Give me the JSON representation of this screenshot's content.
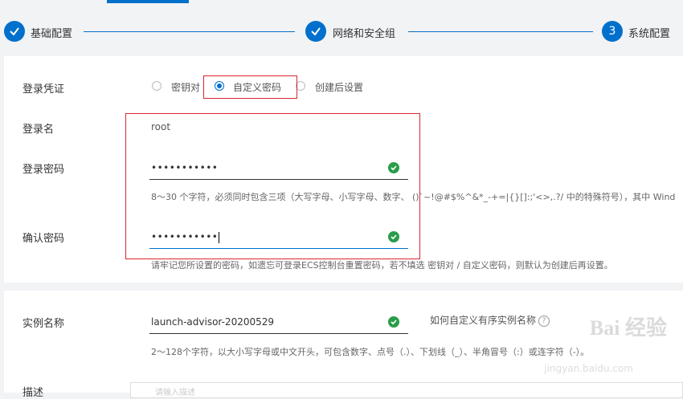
{
  "steps": [
    {
      "label": "基础配置",
      "state": "done"
    },
    {
      "label": "网络和安全组",
      "state": "done"
    },
    {
      "label": "系统配置",
      "state": "current",
      "number": "3"
    }
  ],
  "login_credential": {
    "label": "登录凭证",
    "options": [
      "密钥对",
      "自定义密码",
      "创建后设置"
    ],
    "selected": "自定义密码"
  },
  "login_name": {
    "label": "登录名",
    "value": "root"
  },
  "login_password": {
    "label": "登录密码",
    "value": "•••••••••••",
    "hint": "8～30 个字符，必须同时包含三项（大写字母、小写字母、数字、 ()`~!@#$%^&*_-+=|{}[]:;'<>,.?/ 中的特殊符号），其中 Wind"
  },
  "confirm_password": {
    "label": "确认密码",
    "value": "•••••••••••",
    "hint": "请牢记您所设置的密码，如遗忘可登录ECS控制台重置密码，若不填选 密钥对 / 自定义密码，则默认为创建后再设置。"
  },
  "instance_name": {
    "label": "实例名称",
    "value": "launch-advisor-20200529",
    "help_link": "如何自定义有序实例名称",
    "hint": "2～128个字符，以大小写字母或中文开头，可包含数字、点号（.）、下划线（_）、半角冒号（:）或连字符（-）。"
  },
  "next_field": {
    "label": "描述",
    "placeholder": "请输入描述"
  },
  "colors": {
    "accent": "#0070cc",
    "success": "#2a9d4a",
    "highlight": "#d9262f"
  },
  "watermark": {
    "brand": "Bai 经验",
    "url": "jingyan.baidu.com"
  }
}
